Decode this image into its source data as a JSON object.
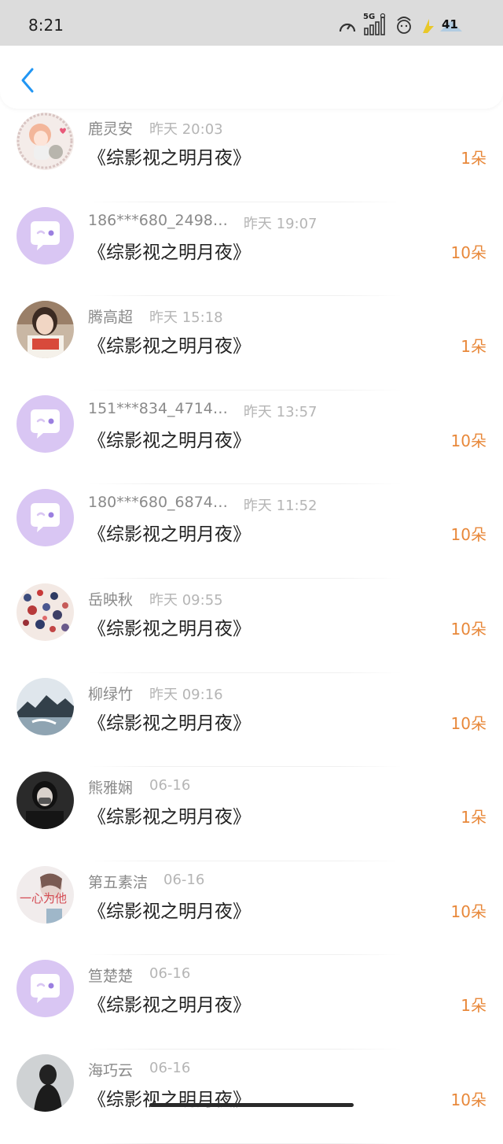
{
  "status_bar": {
    "time": "8:21",
    "network": "5G",
    "battery": "41"
  },
  "header": {
    "back_icon": "chevron-left-icon",
    "accent": "#2196f3"
  },
  "colors": {
    "amount": "#e8883a",
    "default_avatar_bg": "#d9c6f3"
  },
  "gifts": [
    {
      "name": "鹿灵安",
      "time": "昨天 20:03",
      "title": "《综影视之明月夜》",
      "amount": "1朵",
      "avatar": "anime-girl"
    },
    {
      "name": "186***680_2498…",
      "time": "昨天 19:07",
      "title": "《综影视之明月夜》",
      "amount": "10朵",
      "avatar": "default"
    },
    {
      "name": "腾高超",
      "time": "昨天 15:18",
      "title": "《综影视之明月夜》",
      "amount": "1朵",
      "avatar": "photo-girl"
    },
    {
      "name": "151***834_4714…",
      "time": "昨天 13:57",
      "title": "《综影视之明月夜》",
      "amount": "10朵",
      "avatar": "default"
    },
    {
      "name": "180***680_6874…",
      "time": "昨天 11:52",
      "title": "《综影视之明月夜》",
      "amount": "10朵",
      "avatar": "default"
    },
    {
      "name": "岳映秋",
      "time": "昨天 09:55",
      "title": "《综影视之明月夜》",
      "amount": "10朵",
      "avatar": "dots"
    },
    {
      "name": "柳绿竹",
      "time": "昨天 09:16",
      "title": "《综影视之明月夜》",
      "amount": "10朵",
      "avatar": "landscape"
    },
    {
      "name": "熊雅娴",
      "time": "06-16",
      "title": "《综影视之明月夜》",
      "amount": "1朵",
      "avatar": "dark-person"
    },
    {
      "name": "第五素洁",
      "time": "06-16",
      "title": "《综影视之明月夜》",
      "amount": "10朵",
      "avatar": "text-photo",
      "avatar_text": "一心为他"
    },
    {
      "name": "笪楚楚",
      "time": "06-16",
      "title": "《综影视之明月夜》",
      "amount": "1朵",
      "avatar": "default"
    },
    {
      "name": "海巧云",
      "time": "06-16",
      "title": "《综影视之明月夜》",
      "amount": "10朵",
      "avatar": "silhouette"
    }
  ]
}
